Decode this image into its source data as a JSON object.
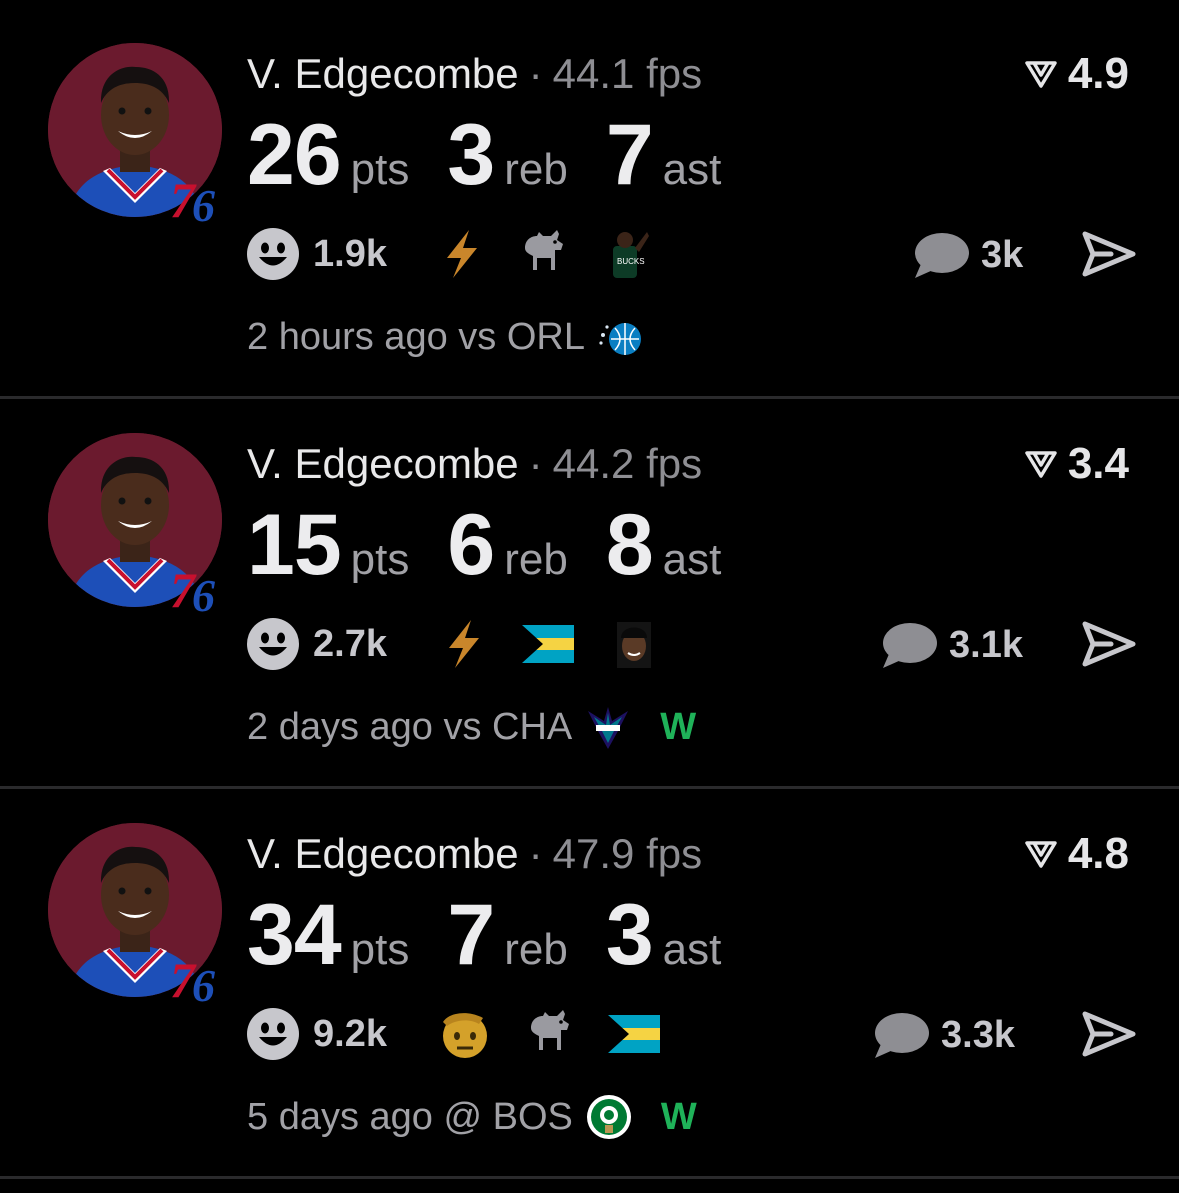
{
  "feed": [
    {
      "player_name": "V. Edgecombe",
      "separator": "·",
      "fps": "44.1 fps",
      "rating": "4.9",
      "stats": [
        {
          "value": "26",
          "label": "pts"
        },
        {
          "value": "3",
          "label": "reb"
        },
        {
          "value": "7",
          "label": "ast"
        }
      ],
      "reaction_count": "1.9k",
      "reactions": [
        "lightning-emoji",
        "goat-emoji",
        "player-celebration-emoji"
      ],
      "comment_count": "3k",
      "time_ago": "2 hours ago",
      "opponent": "vs ORL",
      "opponent_logo": "orlando-magic-logo",
      "result": ""
    },
    {
      "player_name": "V. Edgecombe",
      "separator": "·",
      "fps": "44.2 fps",
      "rating": "3.4",
      "stats": [
        {
          "value": "15",
          "label": "pts"
        },
        {
          "value": "6",
          "label": "reb"
        },
        {
          "value": "8",
          "label": "ast"
        }
      ],
      "reaction_count": "2.7k",
      "reactions": [
        "lightning-emoji",
        "bahamas-flag-emoji",
        "player-face-emoji"
      ],
      "comment_count": "3.1k",
      "time_ago": "2 days ago",
      "opponent": "vs CHA",
      "opponent_logo": "charlotte-hornets-logo",
      "result": "W"
    },
    {
      "player_name": "V. Edgecombe",
      "separator": "·",
      "fps": "47.9 fps",
      "rating": "4.8",
      "stats": [
        {
          "value": "34",
          "label": "pts"
        },
        {
          "value": "7",
          "label": "reb"
        },
        {
          "value": "3",
          "label": "ast"
        }
      ],
      "reaction_count": "9.2k",
      "reactions": [
        "saluting-face-emoji",
        "goat-emoji",
        "bahamas-flag-emoji"
      ],
      "comment_count": "3.3k",
      "time_ago": "5 days ago",
      "opponent": "@ BOS",
      "opponent_logo": "boston-celtics-logo",
      "result": "W"
    }
  ],
  "colors": {
    "background": "#000000",
    "win": "#1fb259",
    "muted": "#8e8e93",
    "avatar_bg": "#6b1a2e"
  }
}
